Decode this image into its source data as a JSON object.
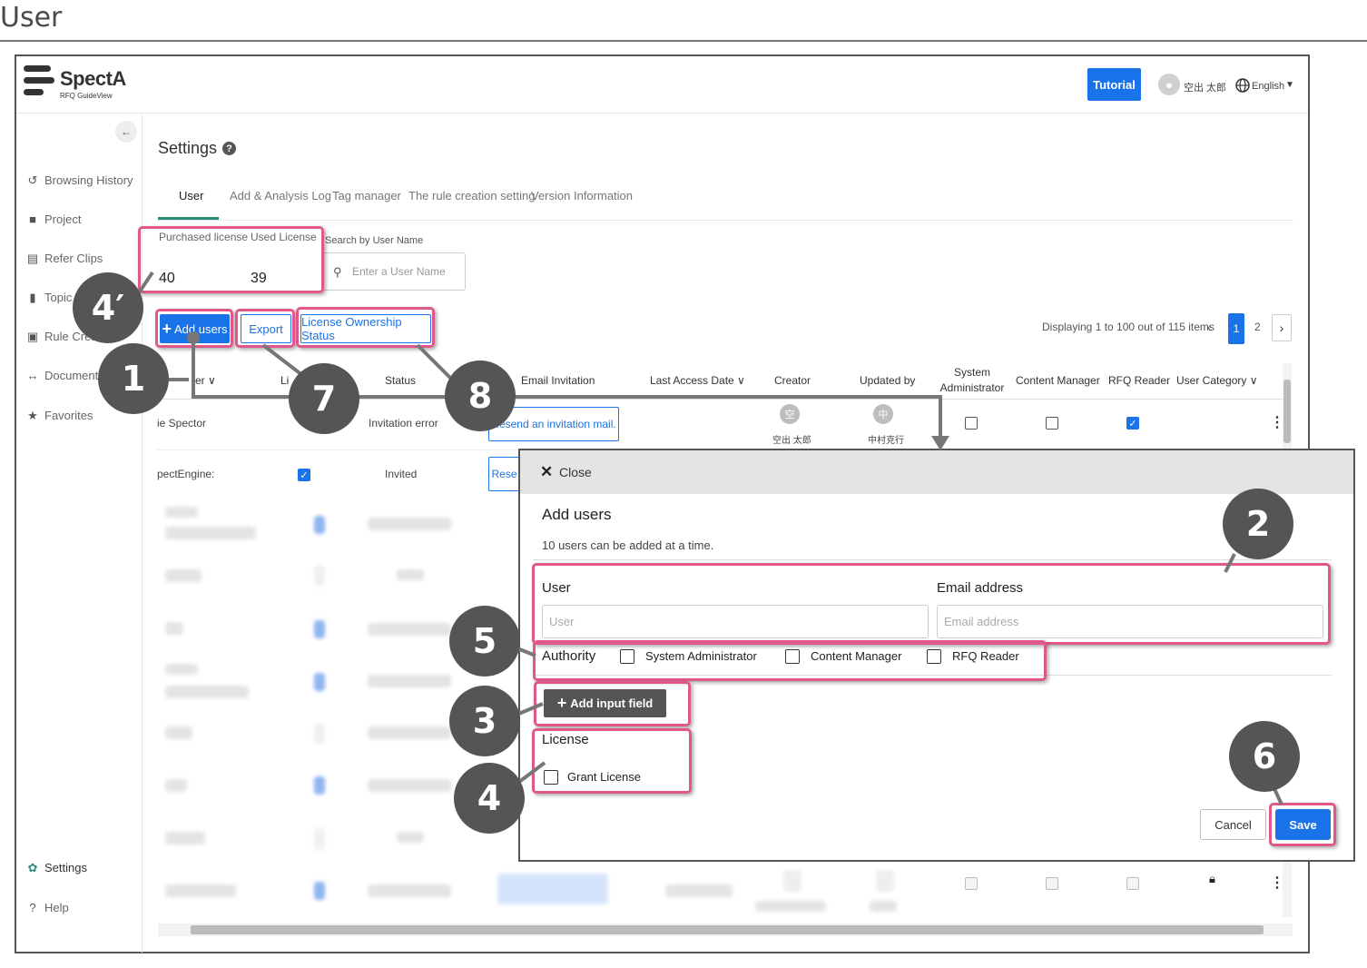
{
  "page_label": "User",
  "app": {
    "name": "SpectA",
    "subtitle": "RFQ GuideView"
  },
  "header": {
    "tutorial_label": "Tutorial",
    "user_name": "空出 太郎",
    "language": "English",
    "avatar_icon": "user-avatar-icon"
  },
  "sidebar": {
    "items": [
      {
        "label": "Browsing History",
        "icon": "history-icon"
      },
      {
        "label": "Project",
        "icon": "briefcase-icon"
      },
      {
        "label": "Refer Clips",
        "icon": "clipboard-icon"
      },
      {
        "label": "Topic",
        "icon": "topic-icon"
      },
      {
        "label": "Rule Crea",
        "icon": "rule-icon"
      },
      {
        "label": "Document C",
        "icon": "compare-icon"
      },
      {
        "label": "Favorites",
        "icon": "star-icon"
      }
    ],
    "bottom": [
      {
        "label": "Settings",
        "icon": "gear-icon"
      },
      {
        "label": "Help",
        "icon": "help-icon"
      }
    ]
  },
  "main": {
    "title": "Settings",
    "tabs": [
      "User",
      "Add & Analysis Log",
      "Tag manager",
      "The rule creation setting",
      "Version Information"
    ],
    "license": {
      "purchased_label": "Purchased license",
      "purchased_value": "40",
      "used_label": "Used License",
      "used_value": "39"
    },
    "search": {
      "label": "Search by User Name",
      "placeholder": "Enter a User Name"
    },
    "buttons": {
      "add_users": "Add users",
      "export": "Export",
      "license_status": "License Ownership Status"
    },
    "pagination": {
      "display_text": "Displaying 1 to 100 out of 115 items",
      "current": "1",
      "next_page": "2"
    },
    "columns": [
      "er",
      "Li",
      "Status",
      "Email Invitation",
      "Last Access Date",
      "Creator",
      "Updated by",
      "System Administrator",
      "Content Manager",
      "RFQ Reader",
      "User Category"
    ],
    "rows": [
      {
        "user": "ie Spector",
        "status": "Invitation error",
        "email_btn": "Resend an invitation mail.",
        "creator_initial": "空",
        "creator": "空出 太郎",
        "updater_initial": "中",
        "updater": "中村克行"
      },
      {
        "user": "pectEngine:",
        "status": "Invited",
        "email_btn": "Rese"
      }
    ]
  },
  "dialog": {
    "close_label": "Close",
    "title": "Add users",
    "subtitle": "10 users can be added at a time.",
    "user_label": "User",
    "user_placeholder": "User",
    "email_label": "Email address",
    "email_placeholder": "Email address",
    "authority_label": "Authority",
    "authority_options": [
      "System Administrator",
      "Content Manager",
      "RFQ Reader"
    ],
    "add_field_label": "Add input field",
    "license_label": "License",
    "grant_label": "Grant License",
    "cancel_label": "Cancel",
    "save_label": "Save"
  },
  "callouts": [
    "1",
    "2",
    "3",
    "4",
    "4′",
    "5",
    "6",
    "7",
    "8"
  ],
  "colors": {
    "primary": "#1a73e8",
    "highlight": "#e0588a",
    "callout": "#555555",
    "tab_underline": "#2a8c78"
  }
}
